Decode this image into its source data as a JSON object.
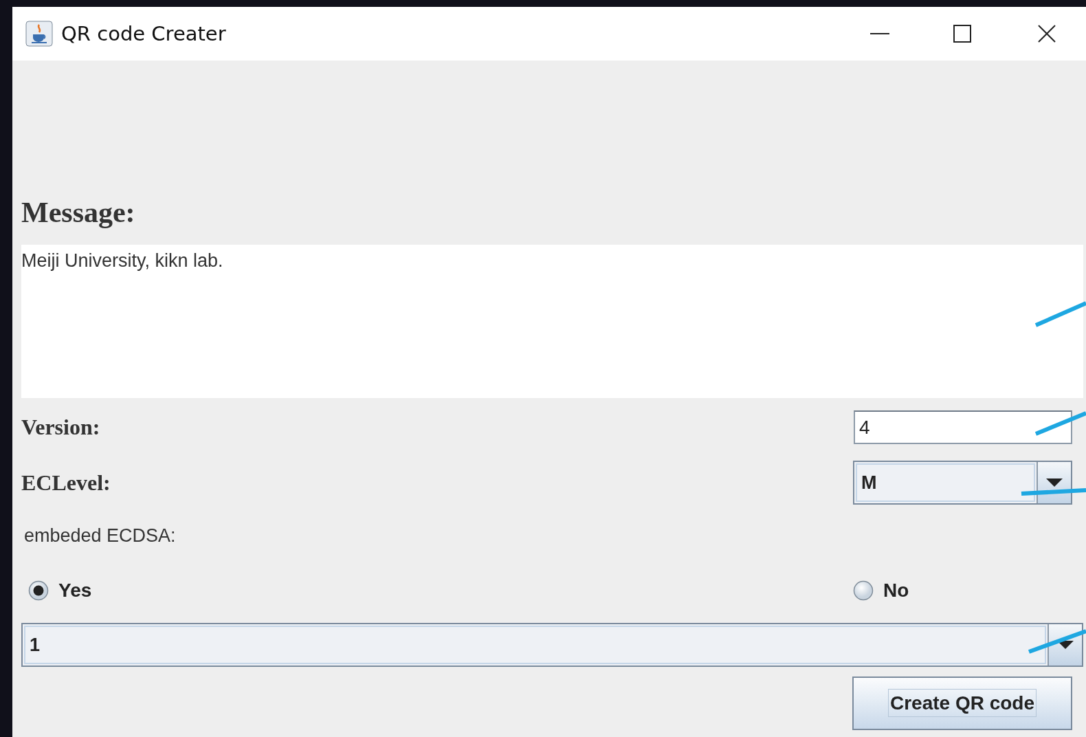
{
  "window": {
    "title": "QR code Creater"
  },
  "message": {
    "label": "Message:",
    "value": "Meiji University, kikn lab."
  },
  "version": {
    "label": "Version:",
    "value": "4"
  },
  "ec_level": {
    "label": "ECLevel:",
    "value": "M"
  },
  "ecdsa": {
    "label": "embeded ECDSA:",
    "options": [
      {
        "label": "Yes",
        "selected": true
      },
      {
        "label": "No",
        "selected": false
      }
    ],
    "key_select": {
      "value": "1"
    }
  },
  "create_button": {
    "label": "Create QR code"
  }
}
